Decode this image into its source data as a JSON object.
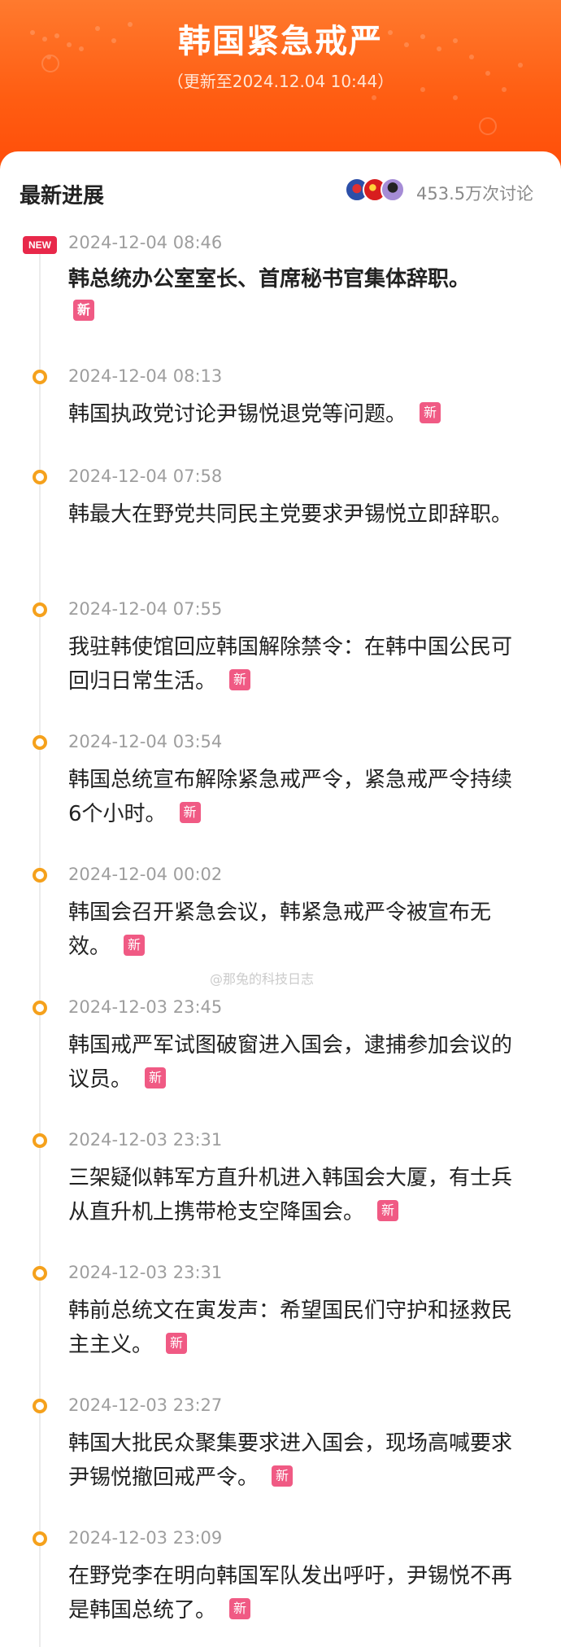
{
  "header": {
    "title": "韩国紧急戒严",
    "update_note": "（更新至2024.12.04 10:44）"
  },
  "section": {
    "title": "最新进展",
    "discussion_count": "453.5万次讨论"
  },
  "badges": {
    "new_en": "NEW",
    "new_cn": "新"
  },
  "watermark": "@那兔的科技日志",
  "entries": [
    {
      "time": "2024-12-04 08:46",
      "text": "韩总统办公室室长、首席秘书官集体辞职。",
      "is_new": true,
      "tag_new": true
    },
    {
      "time": "2024-12-04 08:13",
      "text": "韩国执政党讨论尹锡悦退党等问题。",
      "is_new": false,
      "tag_new": true
    },
    {
      "time": "2024-12-04 07:58",
      "text": "韩最大在野党共同民主党要求尹锡悦立即辞职。",
      "is_new": false,
      "tag_new": false
    },
    {
      "time": "2024-12-04 07:55",
      "text": "我驻韩使馆回应韩国解除禁令：在韩中国公民可回归日常生活。",
      "is_new": false,
      "tag_new": true
    },
    {
      "time": "2024-12-04 03:54",
      "text": "韩国总统宣布解除紧急戒严令，紧急戒严令持续6个小时。",
      "is_new": false,
      "tag_new": true
    },
    {
      "time": "2024-12-04 00:02",
      "text": "韩国会召开紧急会议，韩紧急戒严令被宣布无效。",
      "is_new": false,
      "tag_new": true
    },
    {
      "time": "2024-12-03 23:45",
      "text": "韩国戒严军试图破窗进入国会，逮捕参加会议的议员。",
      "is_new": false,
      "tag_new": true
    },
    {
      "time": "2024-12-03 23:31",
      "text": "三架疑似韩军方直升机进入韩国会大厦，有士兵从直升机上携带枪支空降国会。",
      "is_new": false,
      "tag_new": true
    },
    {
      "time": "2024-12-03 23:31",
      "text": "韩前总统文在寅发声：希望国民们守护和拯救民主主义。",
      "is_new": false,
      "tag_new": true
    },
    {
      "time": "2024-12-03 23:27",
      "text": "韩国大批民众聚集要求进入国会，现场高喊要求尹锡悦撤回戒严令。",
      "is_new": false,
      "tag_new": true
    },
    {
      "time": "2024-12-03 23:09",
      "text": "在野党李在明向韩国军队发出呼吁，尹锡悦不再是韩国总统了。",
      "is_new": false,
      "tag_new": true
    }
  ]
}
